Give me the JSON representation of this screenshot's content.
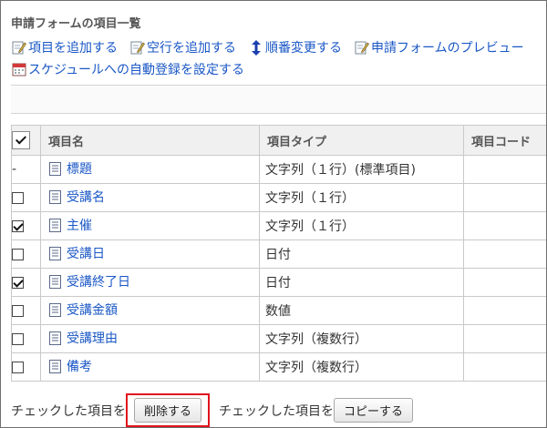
{
  "title": "申請フォームの項目一覧",
  "actions": {
    "add_item": "項目を追加する",
    "add_blank_row": "空行を追加する",
    "reorder": "順番変更する",
    "preview": "申請フォームのプレビュー",
    "schedule": "スケジュールへの自動登録を設定する"
  },
  "table": {
    "headers": {
      "name": "項目名",
      "type": "項目タイプ",
      "code": "項目コード"
    },
    "rows": [
      {
        "check": "dash",
        "name": "標題",
        "type": "文字列（１行）(標準項目)",
        "code": ""
      },
      {
        "check": "off",
        "name": "受講名",
        "type": "文字列（１行）",
        "code": ""
      },
      {
        "check": "on",
        "name": "主催",
        "type": "文字列（１行）",
        "code": ""
      },
      {
        "check": "off",
        "name": "受講日",
        "type": "日付",
        "code": ""
      },
      {
        "check": "on",
        "name": "受講終了日",
        "type": "日付",
        "code": ""
      },
      {
        "check": "off",
        "name": "受講金額",
        "type": "数値",
        "code": ""
      },
      {
        "check": "off",
        "name": "受講理由",
        "type": "文字列（複数行）",
        "code": ""
      },
      {
        "check": "off",
        "name": "備考",
        "type": "文字列（複数行）",
        "code": ""
      }
    ]
  },
  "bottom": {
    "prefix1": "チェックした項目を",
    "delete_label": "削除する",
    "prefix2": "チェックした項目を",
    "copy_label": "コピーする"
  },
  "colors": {
    "link": "#1a57c6",
    "highlight": "#e0141c",
    "header_bg": "#f0f0f0"
  }
}
